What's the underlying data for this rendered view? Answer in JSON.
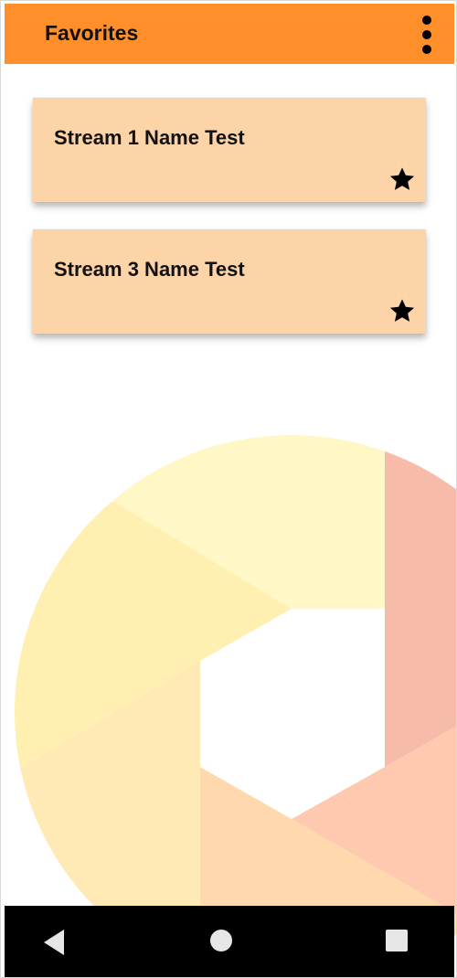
{
  "app_bar": {
    "title": "Favorites",
    "background_color": "#ff8f2a",
    "menu_icon": "more-vertical-icon"
  },
  "favorites": [
    {
      "name": "Stream 1 Name Test",
      "favorited": true,
      "icon": "star-icon"
    },
    {
      "name": "Stream 3 Name Test",
      "favorited": true,
      "icon": "star-icon"
    }
  ],
  "theme": {
    "card_color": "#fcd4a7",
    "background_art_colors": [
      "#fff7c5",
      "#fff0b2",
      "#ffe9b4",
      "#ffd9ad",
      "#ffc9b0",
      "#f7bba9"
    ]
  },
  "navigation": {
    "back_icon": "back-triangle-icon",
    "home_icon": "home-circle-icon",
    "recents_icon": "recents-square-icon"
  }
}
